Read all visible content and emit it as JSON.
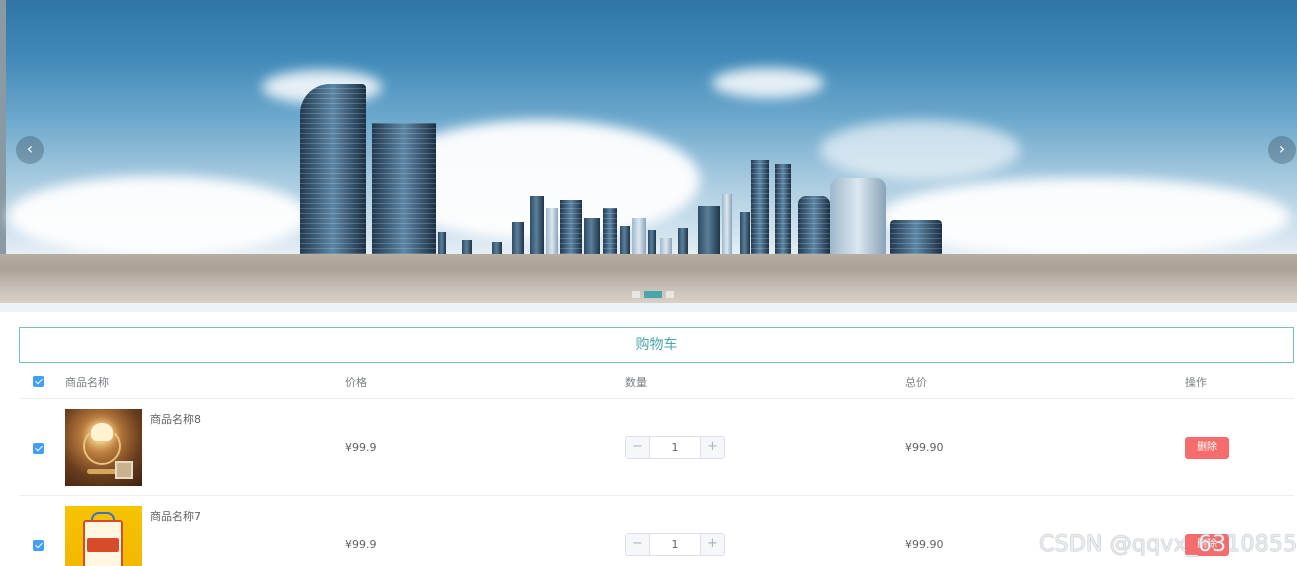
{
  "banner": {
    "prev_icon": "chevron-left",
    "next_icon": "chevron-right",
    "slide_count": 3,
    "active_slide": 2
  },
  "cart": {
    "title": "购物车",
    "columns": {
      "name": "商品名称",
      "price": "价格",
      "quantity": "数量",
      "total": "总价",
      "action": "操作"
    },
    "items": [
      {
        "name": "商品名称8",
        "price": "¥99.9",
        "quantity": "1",
        "total": "¥99.90",
        "delete_label": "删除",
        "checked": true,
        "image": "table-lamp"
      },
      {
        "name": "商品名称7",
        "price": "¥99.9",
        "quantity": "1",
        "total": "¥99.90",
        "delete_label": "删除",
        "checked": true,
        "image": "snack-box"
      }
    ],
    "stepper": {
      "minus": "−",
      "plus": "+"
    }
  },
  "watermark": "CSDN @qqvx_6310855",
  "colors": {
    "accent": "#4aa6a8",
    "checkbox": "#409eff",
    "danger": "#f56c6c"
  }
}
